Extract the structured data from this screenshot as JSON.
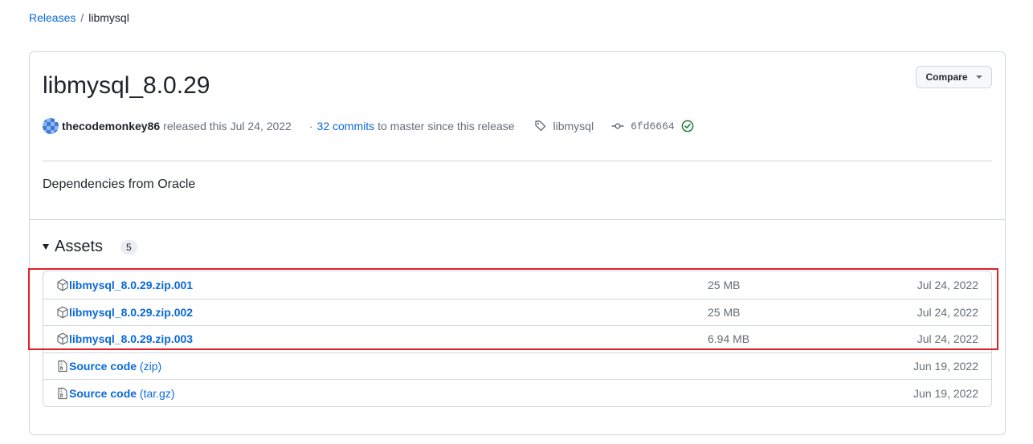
{
  "breadcrumb": {
    "parent": "Releases",
    "separator": "/",
    "current": "libmysql"
  },
  "release": {
    "title": "libmysql_8.0.29",
    "compare_label": "Compare",
    "author": "thecodemonkey86",
    "released_text": "released this",
    "date": "Jul 24, 2022",
    "dot": "·",
    "commits_link": "32 commits",
    "commits_suffix": "to master since this release",
    "tag": "libmysql",
    "commit_sha": "6fd6664",
    "description": "Dependencies from Oracle"
  },
  "assets": {
    "label": "Assets",
    "count": "5",
    "items": [
      {
        "name": "libmysql_8.0.29.zip.001",
        "suffix": "",
        "size": "25 MB",
        "date": "Jul 24, 2022",
        "icon": "package-icon"
      },
      {
        "name": "libmysql_8.0.29.zip.002",
        "suffix": "",
        "size": "25 MB",
        "date": "Jul 24, 2022",
        "icon": "package-icon"
      },
      {
        "name": "libmysql_8.0.29.zip.003",
        "suffix": "",
        "size": "6.94 MB",
        "date": "Jul 24, 2022",
        "icon": "package-icon"
      },
      {
        "name": "Source code",
        "suffix": "(zip)",
        "size": "",
        "date": "Jun 19, 2022",
        "icon": "file-zip-icon"
      },
      {
        "name": "Source code",
        "suffix": "(tar.gz)",
        "size": "",
        "date": "Jun 19, 2022",
        "icon": "file-zip-icon"
      }
    ]
  },
  "colors": {
    "link": "#0969da",
    "highlight": "#e0202a",
    "verified": "#1a7f37"
  }
}
